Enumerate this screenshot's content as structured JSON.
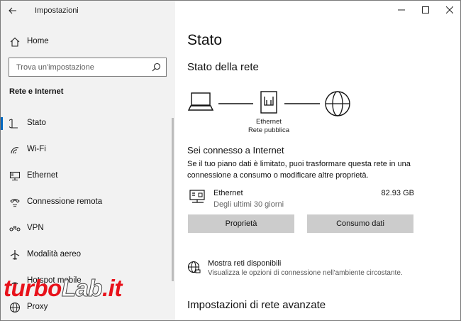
{
  "app": {
    "title": "Impostazioni"
  },
  "sidebar": {
    "home_label": "Home",
    "search_placeholder": "Trova un'impostazione",
    "section_heading": "Rete e Internet",
    "items": [
      {
        "label": "Stato",
        "icon": "status-icon",
        "active": true
      },
      {
        "label": "Wi-Fi",
        "icon": "wifi-icon"
      },
      {
        "label": "Ethernet",
        "icon": "ethernet-icon"
      },
      {
        "label": "Connessione remota",
        "icon": "dialup-icon"
      },
      {
        "label": "VPN",
        "icon": "vpn-icon"
      },
      {
        "label": "Modalità aereo",
        "icon": "airplane-icon"
      },
      {
        "label": "Hotspot mobile",
        "icon": "hotspot-icon"
      },
      {
        "label": "Proxy",
        "icon": "globe-icon"
      }
    ]
  },
  "main": {
    "page_title": "Stato",
    "network_status_title": "Stato della rete",
    "diagram": {
      "adapter_name": "Ethernet",
      "network_profile": "Rete pubblica"
    },
    "connected_title": "Sei connesso a Internet",
    "description": "Se il tuo piano dati è limitato, puoi trasformare questa rete in una connessione a consumo o modificare altre proprietà.",
    "usage": {
      "name": "Ethernet",
      "period": "Degli ultimi 30 giorni",
      "amount": "82.93 GB"
    },
    "buttons": {
      "properties": "Proprietà",
      "data_usage": "Consumo dati"
    },
    "show_networks": {
      "title": "Mostra reti disponibili",
      "subtitle": "Visualizza le opzioni di connessione nell'ambiente circostante."
    },
    "advanced_title": "Impostazioni di rete avanzate"
  },
  "watermark": {
    "text_red": "turbo",
    "text_white": "Lab",
    "text_tail": ".it"
  },
  "colors": {
    "accent": "#0067c0",
    "sidebar_bg": "#f2f2f2",
    "button_bg": "#cccccc",
    "watermark_red": "#e8121b"
  }
}
